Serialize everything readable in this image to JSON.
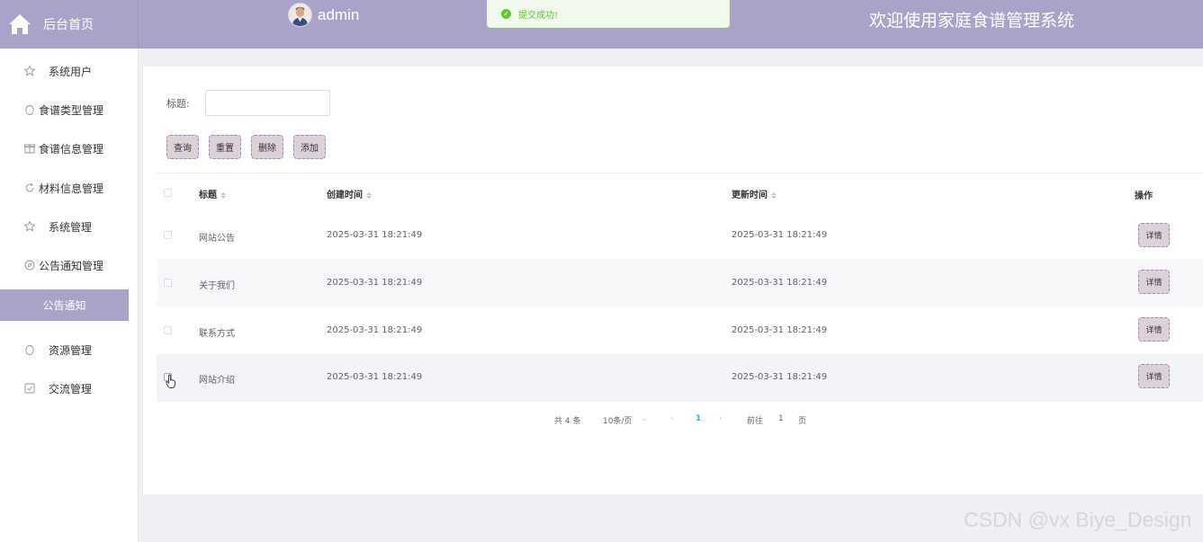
{
  "header": {
    "home_label": "后台首页",
    "username": "admin",
    "system_title": "欢迎使用家庭食谱管理系统"
  },
  "toast": {
    "message": "提交成功!",
    "type": "success"
  },
  "sidebar": {
    "items": [
      {
        "label": "系统用户",
        "icon": "star-icon"
      },
      {
        "label": "食谱类型管理",
        "icon": "egg-icon"
      },
      {
        "label": "食谱信息管理",
        "icon": "gift-icon"
      },
      {
        "label": "材料信息管理",
        "icon": "refresh-icon"
      },
      {
        "label": "系统管理",
        "icon": "star-icon"
      },
      {
        "label": "公告通知管理",
        "icon": "compass-icon"
      },
      {
        "label": "公告通知",
        "active": true
      },
      {
        "label": "资源管理",
        "icon": "egg-icon"
      },
      {
        "label": "交流管理",
        "icon": "checkbox-icon"
      }
    ]
  },
  "filter": {
    "title_label": "标题:",
    "title_value": ""
  },
  "buttons": {
    "query": "查询",
    "reset": "重置",
    "delete": "删除",
    "add": "添加"
  },
  "table": {
    "headers": {
      "title": "标题",
      "created": "创建时间",
      "updated": "更新时间",
      "actions": "操作"
    },
    "rows": [
      {
        "title": "网站公告",
        "created": "2025-03-31 18:21:49",
        "updated": "2025-03-31 18:21:49",
        "action": "详情"
      },
      {
        "title": "关于我们",
        "created": "2025-03-31 18:21:49",
        "updated": "2025-03-31 18:21:49",
        "action": "详情"
      },
      {
        "title": "联系方式",
        "created": "2025-03-31 18:21:49",
        "updated": "2025-03-31 18:21:49",
        "action": "详情"
      },
      {
        "title": "网站介绍",
        "created": "2025-03-31 18:21:49",
        "updated": "2025-03-31 18:21:49",
        "action": "详情"
      }
    ]
  },
  "pagination": {
    "total": "共 4 条",
    "page_size": "10条/页",
    "current_page": "1",
    "goto_label": "前往",
    "goto_value": "1",
    "page_suffix": "页"
  },
  "watermark": "CSDN @vx Biye_Design",
  "colors": {
    "theme": "#aaa2c8",
    "button_bg": "#ddd1d9",
    "success": "#67c23a"
  }
}
